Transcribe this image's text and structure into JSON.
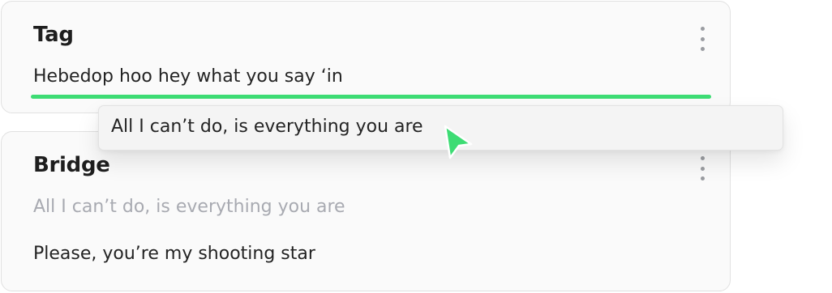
{
  "cards": [
    {
      "title": "Tag",
      "input_value": "Hebedop hoo hey what you say ‘in"
    },
    {
      "title": "Bridge",
      "placeholder_line": "All I can’t do, is everything you are",
      "lyric_line": "Please, you’re my shooting star"
    }
  ],
  "suggestion": {
    "text": "All I can’t do, is everything you are"
  },
  "icons": {
    "card_menu": "more-vertical-icon",
    "pointer": "cursor-arrow-icon"
  },
  "colors": {
    "accent": "#3ddc74",
    "muted_text": "#a8aab1",
    "card_background": "#fafafa"
  }
}
